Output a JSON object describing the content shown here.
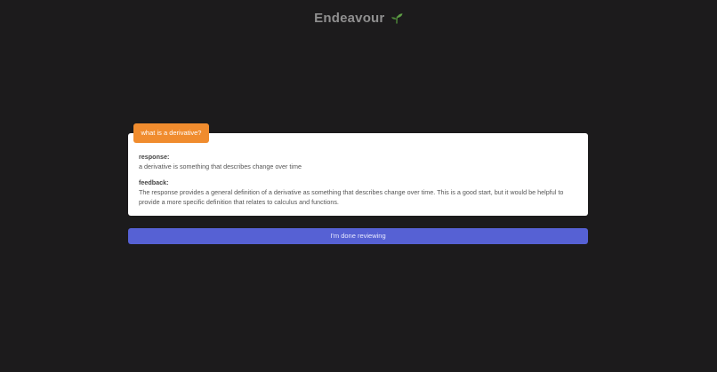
{
  "header": {
    "app_title": "Endeavour",
    "title_icon": "sprout-icon"
  },
  "review": {
    "question": "what is a derivative?",
    "response_label": "response:",
    "response_text": "a derivative is something that describes change over time",
    "feedback_label": "feedback:",
    "feedback_text": "The response provides a general definition of a derivative as something that describes change over time. This is a good start, but it would be helpful to provide a more specific definition that relates to calculus and functions."
  },
  "actions": {
    "done_label": "I'm done reviewing"
  },
  "colors": {
    "background": "#1c1b1c",
    "accent_orange": "#f08c2e",
    "button_blue": "#5661d4",
    "sprout_green": "#4f8a3a"
  }
}
